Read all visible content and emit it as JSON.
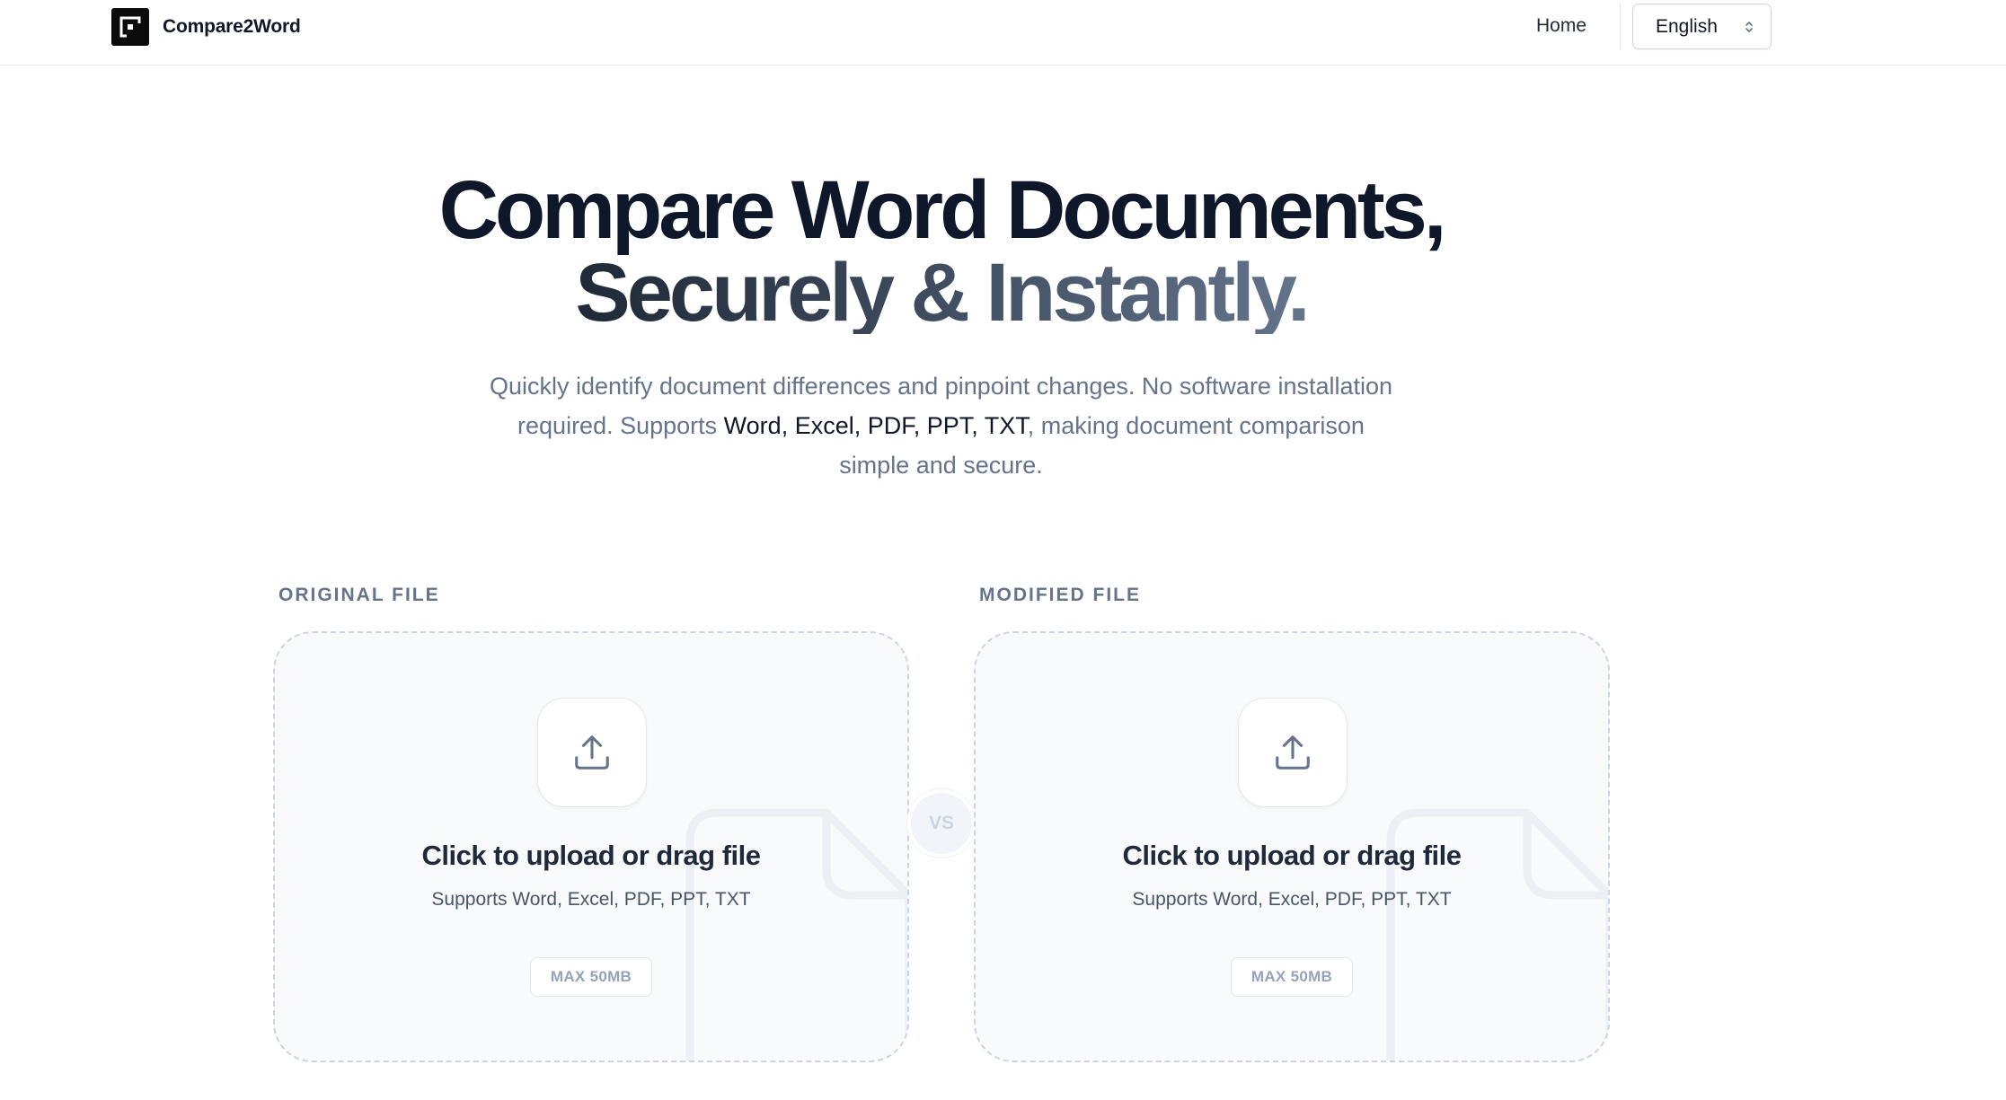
{
  "brand": {
    "name": "Compare2Word"
  },
  "nav": {
    "home": "Home",
    "language": "English"
  },
  "hero": {
    "title_line1": "Compare Word Documents,",
    "title_line2": "Securely & Instantly.",
    "subtitle_part1": "Quickly identify document differences and pinpoint changes. No software installation required. Supports ",
    "subtitle_formats": "Word, Excel, PDF, PPT, TXT",
    "subtitle_part2": ", making document comparison simple and secure."
  },
  "upload": {
    "original_label": "ORIGINAL FILE",
    "modified_label": "MODIFIED FILE",
    "vs": "VS",
    "original": {
      "title": "Click to upload or drag file",
      "supports": "Supports Word, Excel, PDF, PPT, TXT",
      "max": "MAX 50MB"
    },
    "modified": {
      "title": "Click to upload or drag file",
      "supports": "Supports Word, Excel, PDF, PPT, TXT",
      "max": "MAX 50MB"
    }
  },
  "icons": {
    "logo": "logo-mark-icon",
    "language_chevron": "chevron-up-down-icon",
    "upload": "upload-icon",
    "doc_watermark": "document-icon"
  },
  "colors": {
    "heading": "#0f172a",
    "muted": "#64748b",
    "dropzone_bg": "#f8fafc",
    "dropzone_border": "#cbd5e1"
  }
}
